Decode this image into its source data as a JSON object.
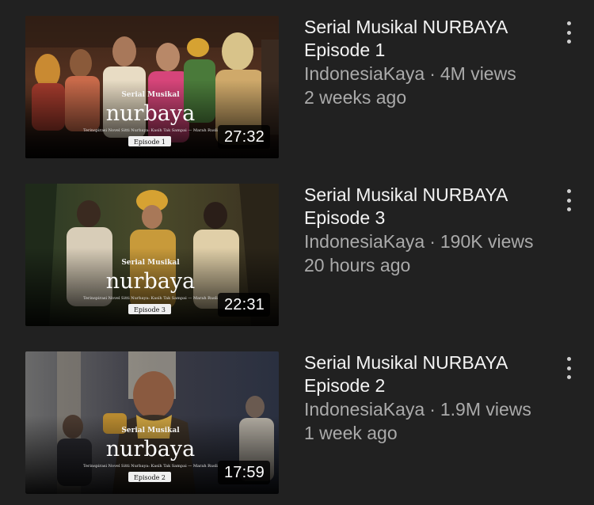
{
  "videos": [
    {
      "title": "Serial Musikal NURBAYA\nEpisode 1",
      "channel": "IndonesiaKaya",
      "separator": "·",
      "views": "4M views",
      "age": "2 weeks ago",
      "duration": "27:32",
      "thumb_text": {
        "series": "Serial Musikal",
        "logo": "nurbaya",
        "tagline": "Terinspirasi Novel Sitti Nurbaya: Kasih Tak Sampai — Marah Rusli",
        "episode": "Episode 1"
      }
    },
    {
      "title": "Serial Musikal NURBAYA\nEpisode 3",
      "channel": "IndonesiaKaya",
      "separator": "·",
      "views": "190K views",
      "age": "20 hours ago",
      "duration": "22:31",
      "thumb_text": {
        "series": "Serial Musikal",
        "logo": "nurbaya",
        "tagline": "Terinspirasi Novel Sitti Nurbaya: Kasih Tak Sampai — Marah Rusli",
        "episode": "Episode 3"
      }
    },
    {
      "title": "Serial Musikal NURBAYA\nEpisode 2",
      "channel": "IndonesiaKaya",
      "separator": "·",
      "views": "1.9M views",
      "age": "1 week ago",
      "duration": "17:59",
      "thumb_text": {
        "series": "Serial Musikal",
        "logo": "nurbaya",
        "tagline": "Terinspirasi Novel Sitti Nurbaya: Kasih Tak Sampai — Marah Rusli",
        "episode": "Episode 2"
      }
    }
  ],
  "icons": {
    "menu": "more-vertical-icon"
  },
  "colors": {
    "background": "#212121",
    "title": "#f4f4f4",
    "meta": "#aaaaaa",
    "duration_bg": "#000000"
  }
}
